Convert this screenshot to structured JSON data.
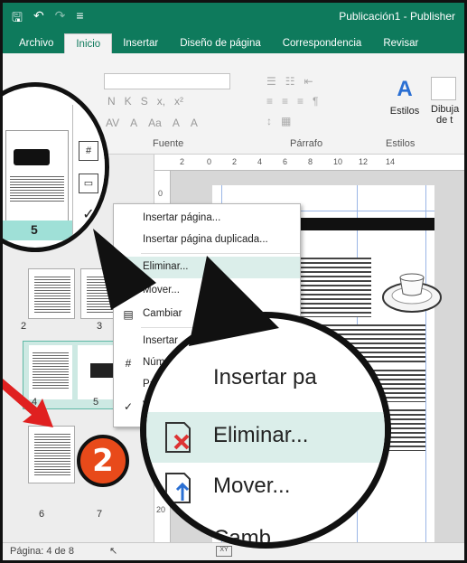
{
  "titlebar": {
    "title": "Publicación1 - Publisher",
    "save_icon": "save-icon",
    "undo_icon": "undo-icon",
    "redo_icon": "redo-icon"
  },
  "tabs": [
    "Archivo",
    "Inicio",
    "Insertar",
    "Diseño de página",
    "Correspondencia",
    "Revisar"
  ],
  "active_tab": "Inicio",
  "ribbon": {
    "groups": {
      "fuente": "Fuente",
      "parrafo": "Párrafo",
      "estilos": "Estilos"
    },
    "styles_label": "Estilos",
    "draw_label": "Dibuja",
    "draw_label2": "de t",
    "font_buttons": [
      "N",
      "K",
      "S",
      "x,",
      "x²"
    ],
    "font_buttons2": [
      "AV",
      "A",
      "Aa",
      "A",
      "A"
    ]
  },
  "ruler": {
    "marks": [
      "2",
      "0",
      "2",
      "4",
      "6",
      "8",
      "10",
      "12",
      "14"
    ],
    "v_marks": [
      "0",
      "2",
      "20"
    ]
  },
  "thumbnails": {
    "pages": [
      "2",
      "3",
      "4",
      "5",
      "6",
      "7"
    ]
  },
  "context_menu": {
    "items": [
      {
        "label": "Insertar página...",
        "icon": ""
      },
      {
        "label": "Insertar página duplicada...",
        "icon": ""
      },
      {
        "label": "Eliminar...",
        "icon": "delete-page-icon"
      },
      {
        "label": "Mover...",
        "icon": "move-page-icon"
      },
      {
        "label": "Cambiar",
        "icon": "change-page-icon"
      },
      {
        "label": "Insertar",
        "icon": ""
      },
      {
        "label": "Núme",
        "icon": "page-number-icon"
      },
      {
        "label": "Pá",
        "icon": ""
      },
      {
        "label": "V",
        "icon": ""
      }
    ]
  },
  "magnifier_left": {
    "page_number": "5"
  },
  "magnifier_zoom": {
    "items": [
      "Insertar pa",
      "Eliminar...",
      "Mover...",
      "Camb"
    ]
  },
  "badge": {
    "text": "2"
  },
  "status": {
    "page": "Página: 4 de 8"
  },
  "colors": {
    "accent": "#0e7a5c",
    "highlight": "#dbeeea",
    "callout": "#e84a1a"
  }
}
